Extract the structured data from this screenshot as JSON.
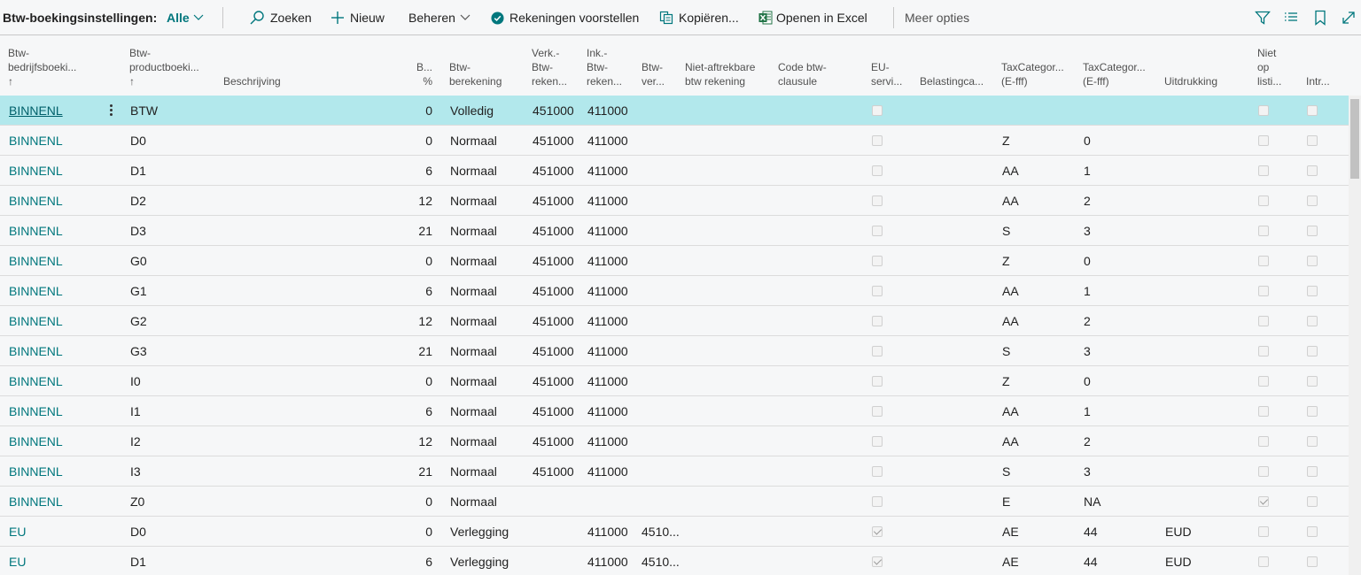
{
  "toolbar": {
    "title": "Btw-boekingsinstellingen:",
    "view": "Alle",
    "search": "Zoeken",
    "new": "Nieuw",
    "manage": "Beheren",
    "suggest_accounts": "Rekeningen voorstellen",
    "copy": "Kopiëren...",
    "open_excel": "Openen in Excel",
    "more_options": "Meer opties",
    "colors": {
      "accent": "#00777d",
      "selected_row": "#b2e8ec",
      "excel_green": "#217346"
    }
  },
  "columns": {
    "bus_group": "Btw-\nbedrijfsboeki...\n↑",
    "prod_group": "Btw-\nproductboeki...\n↑",
    "description": "Beschrijving",
    "pct": "B...\n%",
    "calc": "Btw-\nberekening",
    "sales_acc": "Verk.-\nBtw-\nreken...",
    "purch_acc": "Ink.-\nBtw-\nreken...",
    "rev_acc": "Btw-\nver...",
    "nondeduct": "Niet-aftrekbare\nbtw rekening",
    "clause": "Code btw-\nclausule",
    "eu_service": "EU-\nservi...",
    "tax_cat": "Belastingca...",
    "taxcat1": "TaxCategor...\n(E-fff)",
    "taxcat2": "TaxCategor...\n(E-fff)",
    "expression": "Uitdrukking",
    "not_listed": "Niet\nop\nlisti...",
    "intra": "Intr..."
  },
  "rows": [
    {
      "bus": "BINNENL",
      "prod": "BTW",
      "desc": "",
      "pct": "0",
      "calc": "Volledig",
      "sales": "451000",
      "purch": "411000",
      "rev": "",
      "eu": false,
      "tc1": "",
      "tc2": "",
      "expr": "",
      "notlisted": false,
      "intra": false
    },
    {
      "bus": "BINNENL",
      "prod": "D0",
      "desc": "",
      "pct": "0",
      "calc": "Normaal",
      "sales": "451000",
      "purch": "411000",
      "rev": "",
      "eu": false,
      "tc1": "Z",
      "tc2": "0",
      "expr": "",
      "notlisted": false,
      "intra": false
    },
    {
      "bus": "BINNENL",
      "prod": "D1",
      "desc": "",
      "pct": "6",
      "calc": "Normaal",
      "sales": "451000",
      "purch": "411000",
      "rev": "",
      "eu": false,
      "tc1": "AA",
      "tc2": "1",
      "expr": "",
      "notlisted": false,
      "intra": false
    },
    {
      "bus": "BINNENL",
      "prod": "D2",
      "desc": "",
      "pct": "12",
      "calc": "Normaal",
      "sales": "451000",
      "purch": "411000",
      "rev": "",
      "eu": false,
      "tc1": "AA",
      "tc2": "2",
      "expr": "",
      "notlisted": false,
      "intra": false
    },
    {
      "bus": "BINNENL",
      "prod": "D3",
      "desc": "",
      "pct": "21",
      "calc": "Normaal",
      "sales": "451000",
      "purch": "411000",
      "rev": "",
      "eu": false,
      "tc1": "S",
      "tc2": "3",
      "expr": "",
      "notlisted": false,
      "intra": false
    },
    {
      "bus": "BINNENL",
      "prod": "G0",
      "desc": "",
      "pct": "0",
      "calc": "Normaal",
      "sales": "451000",
      "purch": "411000",
      "rev": "",
      "eu": false,
      "tc1": "Z",
      "tc2": "0",
      "expr": "",
      "notlisted": false,
      "intra": false
    },
    {
      "bus": "BINNENL",
      "prod": "G1",
      "desc": "",
      "pct": "6",
      "calc": "Normaal",
      "sales": "451000",
      "purch": "411000",
      "rev": "",
      "eu": false,
      "tc1": "AA",
      "tc2": "1",
      "expr": "",
      "notlisted": false,
      "intra": false
    },
    {
      "bus": "BINNENL",
      "prod": "G2",
      "desc": "",
      "pct": "12",
      "calc": "Normaal",
      "sales": "451000",
      "purch": "411000",
      "rev": "",
      "eu": false,
      "tc1": "AA",
      "tc2": "2",
      "expr": "",
      "notlisted": false,
      "intra": false
    },
    {
      "bus": "BINNENL",
      "prod": "G3",
      "desc": "",
      "pct": "21",
      "calc": "Normaal",
      "sales": "451000",
      "purch": "411000",
      "rev": "",
      "eu": false,
      "tc1": "S",
      "tc2": "3",
      "expr": "",
      "notlisted": false,
      "intra": false
    },
    {
      "bus": "BINNENL",
      "prod": "I0",
      "desc": "",
      "pct": "0",
      "calc": "Normaal",
      "sales": "451000",
      "purch": "411000",
      "rev": "",
      "eu": false,
      "tc1": "Z",
      "tc2": "0",
      "expr": "",
      "notlisted": false,
      "intra": false
    },
    {
      "bus": "BINNENL",
      "prod": "I1",
      "desc": "",
      "pct": "6",
      "calc": "Normaal",
      "sales": "451000",
      "purch": "411000",
      "rev": "",
      "eu": false,
      "tc1": "AA",
      "tc2": "1",
      "expr": "",
      "notlisted": false,
      "intra": false
    },
    {
      "bus": "BINNENL",
      "prod": "I2",
      "desc": "",
      "pct": "12",
      "calc": "Normaal",
      "sales": "451000",
      "purch": "411000",
      "rev": "",
      "eu": false,
      "tc1": "AA",
      "tc2": "2",
      "expr": "",
      "notlisted": false,
      "intra": false
    },
    {
      "bus": "BINNENL",
      "prod": "I3",
      "desc": "",
      "pct": "21",
      "calc": "Normaal",
      "sales": "451000",
      "purch": "411000",
      "rev": "",
      "eu": false,
      "tc1": "S",
      "tc2": "3",
      "expr": "",
      "notlisted": false,
      "intra": false
    },
    {
      "bus": "BINNENL",
      "prod": "Z0",
      "desc": "",
      "pct": "0",
      "calc": "Normaal",
      "sales": "",
      "purch": "",
      "rev": "",
      "eu": false,
      "tc1": "E",
      "tc2": "NA",
      "expr": "",
      "notlisted": true,
      "intra": false
    },
    {
      "bus": "EU",
      "prod": "D0",
      "desc": "",
      "pct": "0",
      "calc": "Verlegging",
      "sales": "",
      "purch": "411000",
      "rev": "4510...",
      "eu": true,
      "tc1": "AE",
      "tc2": "44",
      "expr": "EUD",
      "notlisted": false,
      "intra": false
    },
    {
      "bus": "EU",
      "prod": "D1",
      "desc": "",
      "pct": "6",
      "calc": "Verlegging",
      "sales": "",
      "purch": "411000",
      "rev": "4510...",
      "eu": true,
      "tc1": "AE",
      "tc2": "44",
      "expr": "EUD",
      "notlisted": false,
      "intra": false
    }
  ]
}
